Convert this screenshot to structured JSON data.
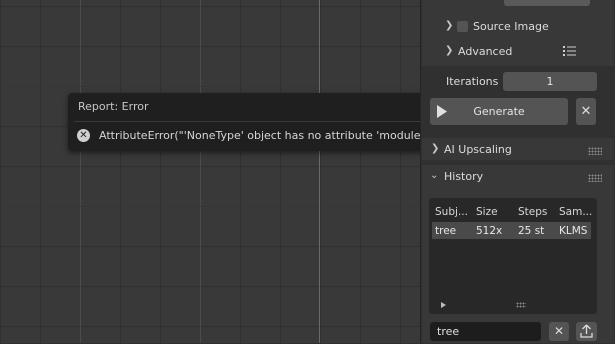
{
  "popup": {
    "title": "Report: Error",
    "message": "AttributeError(\"'NoneType' object has no attribute 'modules'\")"
  },
  "panel": {
    "top_field_value": "",
    "source_image_label": "Source Image",
    "advanced_label": "Advanced",
    "iterations_label": "Iterations",
    "iterations_value": "1",
    "generate_label": "Generate",
    "ai_upscaling_label": "AI Upscaling",
    "history_label": "History",
    "history": {
      "columns": [
        "Subj...",
        "Size",
        "Steps",
        "Sam..."
      ],
      "rows": [
        [
          "tree",
          "512x",
          "25 st",
          "KLMS"
        ]
      ]
    },
    "search_value": "tree"
  },
  "colors": {
    "panel_bg": "#303030",
    "popup_bg": "#1f1f1f",
    "viewport_bg": "#393939"
  },
  "icons": [
    "error-icon",
    "play-icon",
    "close-icon",
    "chevron-right-icon",
    "chevron-down-icon",
    "list-icon",
    "upload-icon",
    "grip-icon"
  ]
}
